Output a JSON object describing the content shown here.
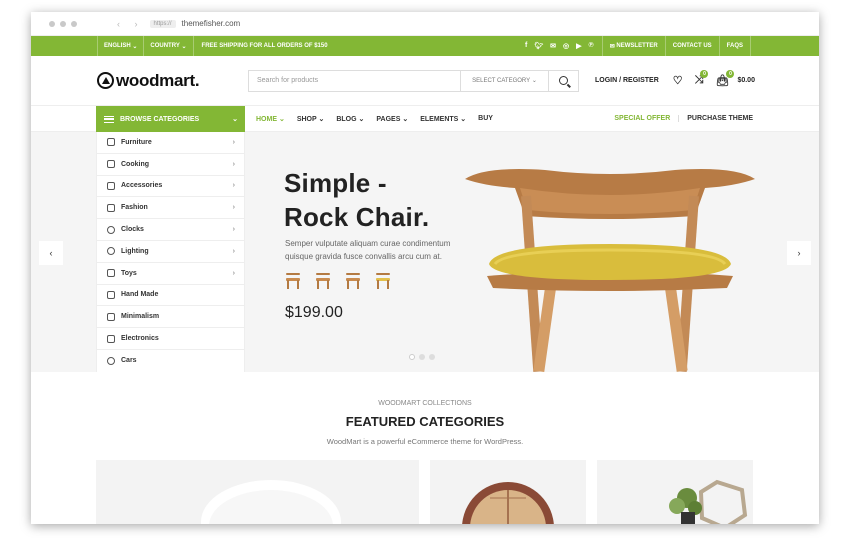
{
  "browser": {
    "protocol": "https://",
    "host": "themefisher.com"
  },
  "topbar": {
    "language": "ENGLISH",
    "country": "COUNTRY",
    "shipping": "FREE SHIPPING FOR ALL ORDERS OF $150",
    "social_icons": [
      "facebook-icon",
      "twitter-icon",
      "mail-icon",
      "instagram-icon",
      "youtube-icon",
      "pinterest-icon"
    ],
    "newsletter": "NEWSLETTER",
    "contact": "CONTACT US",
    "faqs": "FAQS",
    "color": "#83b735"
  },
  "header": {
    "logo": "woodmart.",
    "search_placeholder": "Search for products",
    "category_select": "SELECT CATEGORY",
    "login": "LOGIN / REGISTER",
    "compare_count": "0",
    "cart_count": "0",
    "cart_total": "$0.00"
  },
  "nav": {
    "browse": "BROWSE CATEGORIES",
    "items": [
      "HOME",
      "SHOP",
      "BLOG",
      "PAGES",
      "ELEMENTS",
      "BUY"
    ],
    "special_offer": "SPECIAL OFFER",
    "purchase_theme": "PURCHASE THEME"
  },
  "categories": [
    "Furniture",
    "Cooking",
    "Accessories",
    "Fashion",
    "Clocks",
    "Lighting",
    "Toys",
    "Hand Made",
    "Minimalism",
    "Electronics",
    "Cars"
  ],
  "hero": {
    "title_line1": "Simple -",
    "title_line2": "Rock Chair.",
    "description": "Semper vulputate aliquam curae condimentum quisque gravida fusce convallis arcu cum at.",
    "price": "$199.00",
    "slide_count": 3,
    "active_slide": 1
  },
  "featured": {
    "kicker": "WOODMART COLLECTIONS",
    "title": "FEATURED CATEGORIES",
    "subtitle": "WoodMart is a powerful eCommerce theme for WordPress."
  }
}
